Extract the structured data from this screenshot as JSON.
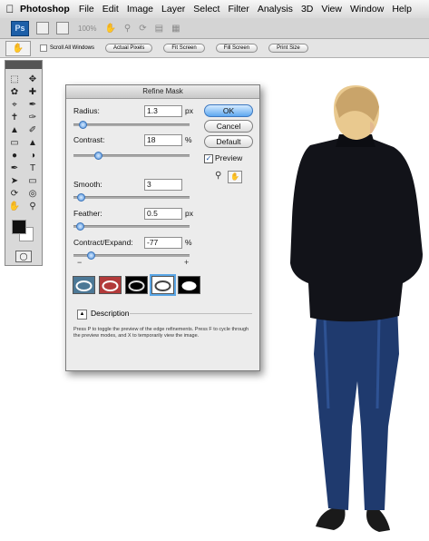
{
  "menubar": {
    "app": "Photoshop",
    "items": [
      "File",
      "Edit",
      "Image",
      "Layer",
      "Select",
      "Filter",
      "Analysis",
      "3D",
      "View",
      "Window",
      "Help"
    ]
  },
  "appbar": {
    "ps_badge": "Ps",
    "zoom": "100%"
  },
  "options": {
    "scroll_all_windows": "Scroll All Windows",
    "actual_pixels": "Actual Pixels",
    "fit_screen": "Fit Screen",
    "fill_screen": "Fill Screen",
    "print_size": "Print Size"
  },
  "dialog": {
    "title": "Refine Mask",
    "radius": {
      "label": "Radius:",
      "value": "1.3",
      "unit": "px",
      "level": 0.05
    },
    "contrast": {
      "label": "Contrast:",
      "value": "18",
      "unit": "%",
      "level": 0.18
    },
    "smooth": {
      "label": "Smooth:",
      "value": "3",
      "level": 0.03
    },
    "feather": {
      "label": "Feather:",
      "value": "0.5",
      "unit": "px",
      "level": 0.02
    },
    "contract_expand": {
      "label": "Contract/Expand:",
      "value": "-77",
      "unit": "%",
      "level": -0.77
    },
    "minus": "−",
    "plus": "+",
    "ok": "OK",
    "cancel": "Cancel",
    "default": "Default",
    "preview": "Preview",
    "description": "Description",
    "help": "Press P to toggle the preview of the edge refinements. Press F to cycle through the preview modes, and X to temporarily view the image."
  }
}
